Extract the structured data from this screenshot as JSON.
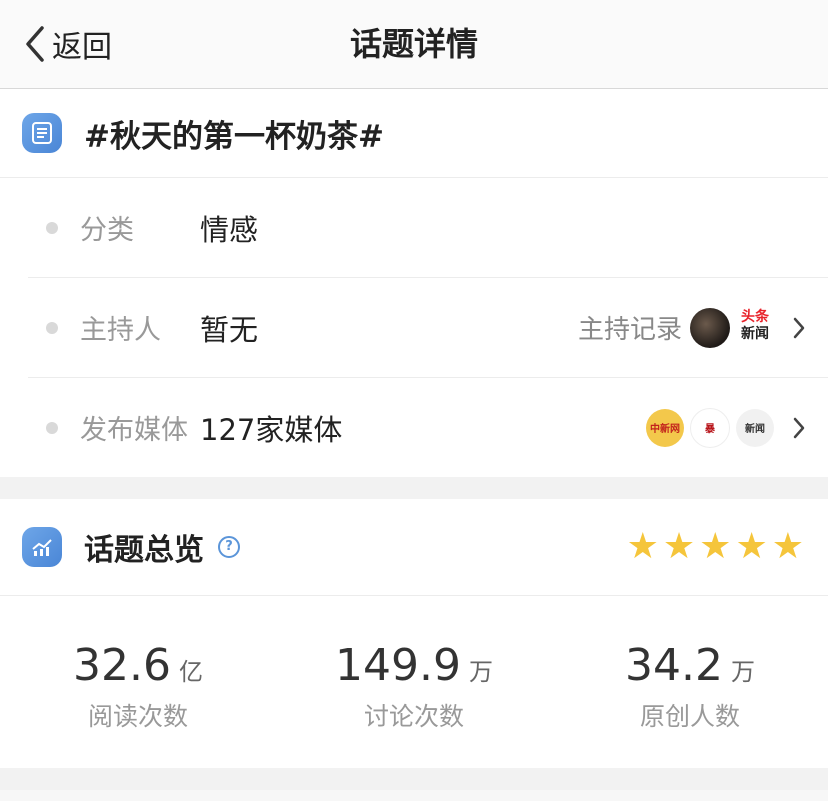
{
  "header": {
    "back_label": "返回",
    "title": "话题详情"
  },
  "topic": {
    "title": "#秋天的第一杯奶茶#"
  },
  "info": {
    "category": {
      "label": "分类",
      "value": "情感"
    },
    "host": {
      "label": "主持人",
      "value": "暂无",
      "record_label": "主持记录",
      "logo_text_top": "头条",
      "logo_text_bottom": "新闻"
    },
    "media": {
      "label": "发布媒体",
      "value": "127家媒体",
      "logos": [
        "中新网",
        "暴",
        "新闻"
      ]
    }
  },
  "overview": {
    "title": "话题总览",
    "help": "?",
    "rating": 5,
    "stats": [
      {
        "value": "32.6",
        "unit": "亿",
        "label": "阅读次数"
      },
      {
        "value": "149.9",
        "unit": "万",
        "label": "讨论次数"
      },
      {
        "value": "34.2",
        "unit": "万",
        "label": "原创人数"
      }
    ]
  }
}
